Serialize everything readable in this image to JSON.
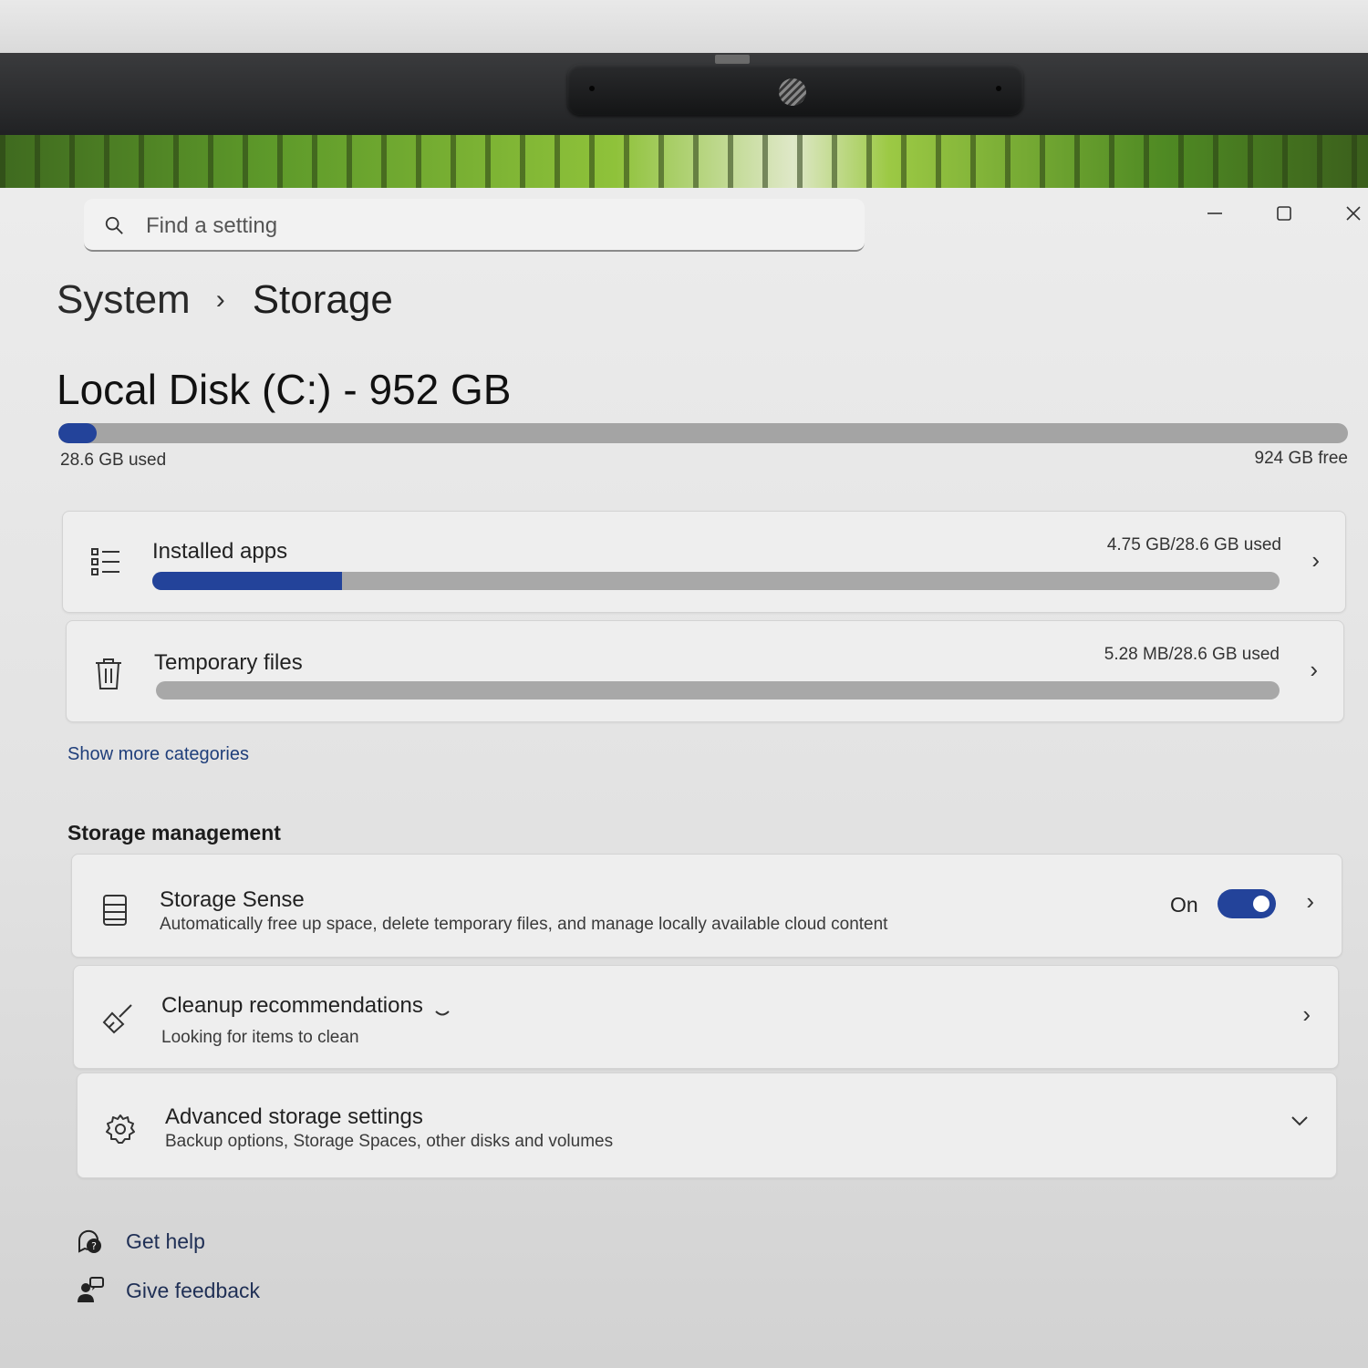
{
  "search": {
    "placeholder": "Find a setting"
  },
  "breadcrumb": {
    "parent": "System",
    "separator": "›",
    "current": "Storage"
  },
  "disk": {
    "title": "Local Disk (C:) - 952 GB",
    "used_label": "28.6 GB used",
    "free_label": "924 GB free",
    "used_fraction": 0.03
  },
  "categories": [
    {
      "label": "Installed apps",
      "usage": "4.75 GB/28.6 GB used",
      "fraction": 0.168,
      "icon": "list-icon"
    },
    {
      "label": "Temporary files",
      "usage": "5.28 MB/28.6 GB used",
      "fraction": 0.0,
      "icon": "trash-icon"
    }
  ],
  "show_more": "Show more categories",
  "storage_management": {
    "title": "Storage management",
    "items": [
      {
        "label": "Storage Sense",
        "sub": "Automatically free up space, delete temporary files, and manage locally available cloud content",
        "toggle_label": "On",
        "toggle_on": true,
        "icon": "storage-drive-icon"
      },
      {
        "label": "Cleanup recommendations",
        "sub": "Looking for items to clean",
        "icon": "broom-icon"
      },
      {
        "label": "Advanced storage settings",
        "sub": "Backup options, Storage Spaces, other disks and volumes",
        "icon": "gear-icon"
      }
    ]
  },
  "footer": {
    "help": "Get help",
    "feedback": "Give feedback"
  },
  "colors": {
    "accent": "#23439a",
    "bar_track": "#a6a6a6",
    "window_bg": "#e6e6e6"
  }
}
